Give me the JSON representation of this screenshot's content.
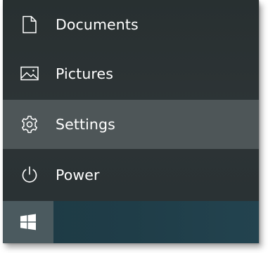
{
  "menu": {
    "items": [
      {
        "label": "Documents",
        "icon": "document-icon"
      },
      {
        "label": "Pictures",
        "icon": "pictures-icon"
      },
      {
        "label": "Settings",
        "icon": "gear-icon",
        "selected": true
      },
      {
        "label": "Power",
        "icon": "power-icon"
      }
    ]
  },
  "taskbar": {
    "start_icon": "windows-logo-icon"
  },
  "colors": {
    "menu_background": "#2c3335",
    "selected_background": "#4e5658",
    "taskbar_background": "#1f3d48",
    "start_button_background": "#4b5a5f",
    "text": "#ffffff"
  }
}
